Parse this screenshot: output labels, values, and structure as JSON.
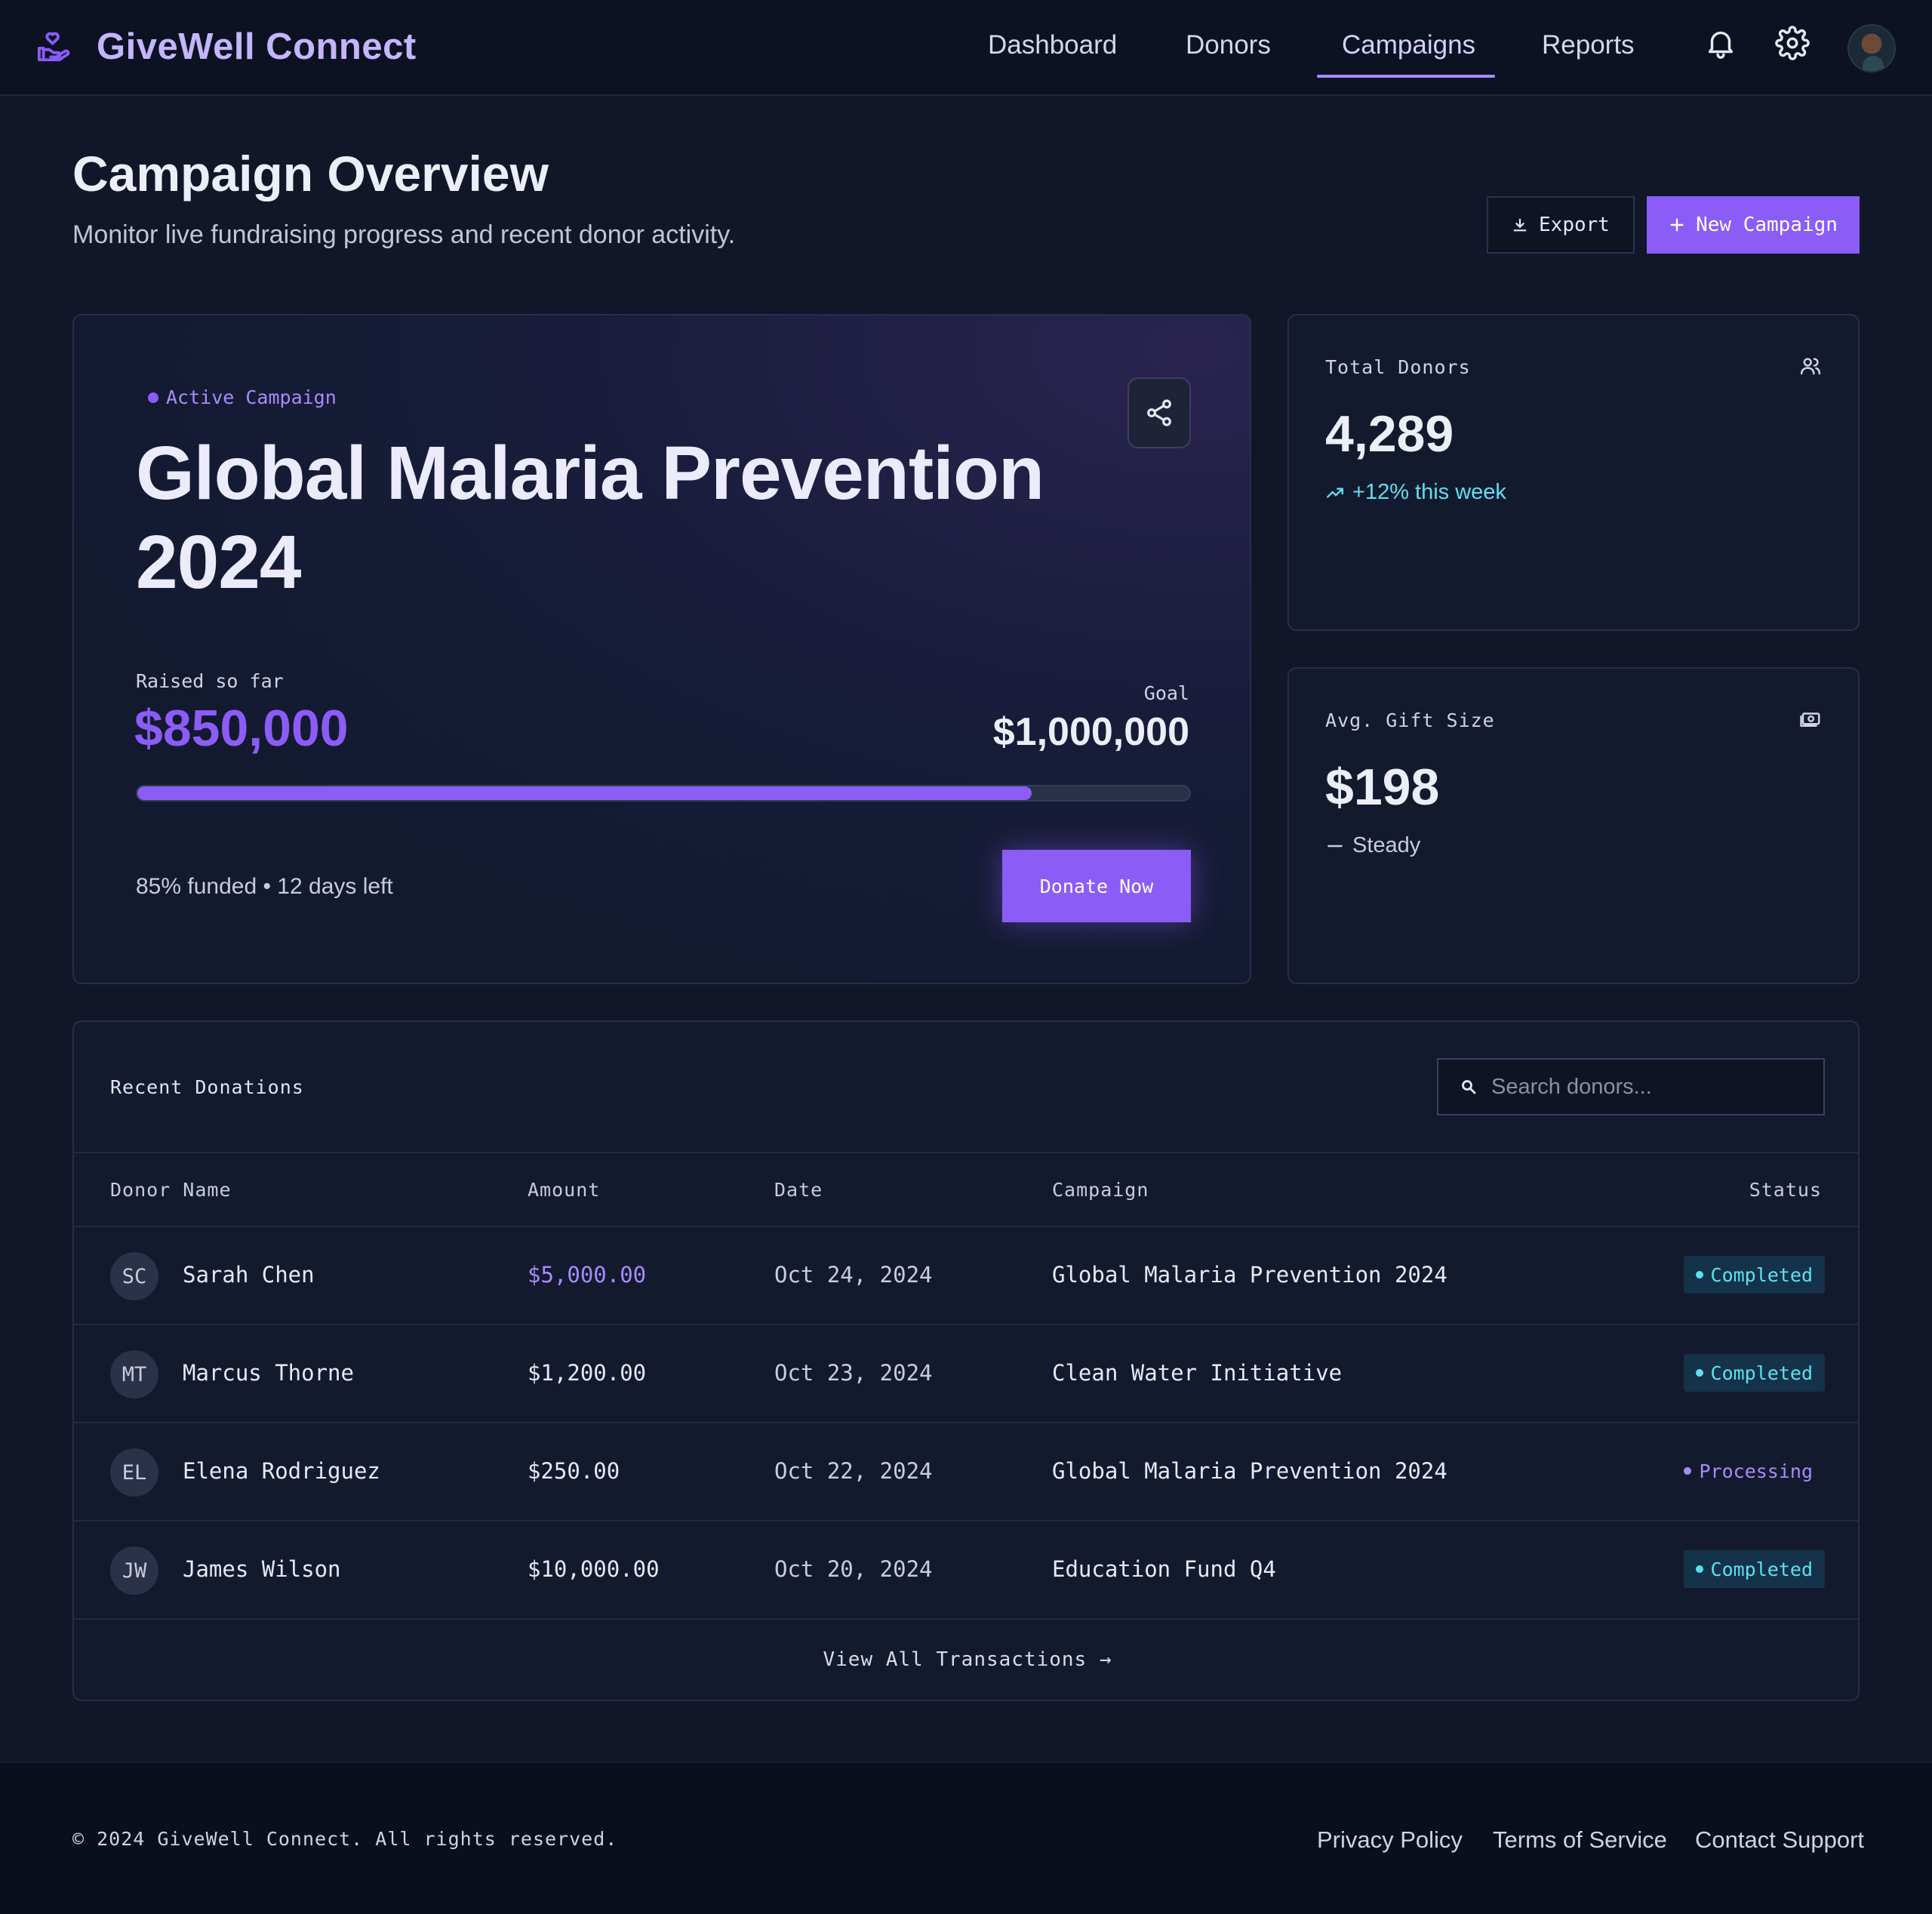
{
  "app": {
    "name": "GiveWell Connect",
    "brand_color": "#8b5cf6"
  },
  "nav": {
    "items": [
      {
        "label": "Dashboard",
        "active": false
      },
      {
        "label": "Donors",
        "active": false
      },
      {
        "label": "Campaigns",
        "active": true
      },
      {
        "label": "Reports",
        "active": false
      }
    ],
    "icons": [
      "bell-icon",
      "gear-icon",
      "avatar"
    ]
  },
  "page": {
    "title": "Campaign Overview",
    "subtitle": "Monitor live fundraising progress and recent donor activity.",
    "export_label": "Export",
    "new_campaign_label": "New Campaign"
  },
  "campaign": {
    "tag": "Active Campaign",
    "title": "Global Malaria Prevention 2024",
    "raised_label": "Raised so far",
    "raised": "$850,000",
    "goal_label": "Goal",
    "goal": "$1,000,000",
    "progress_fraction": 0.85,
    "meta": "85% funded • 12 days left",
    "donate_label": "Donate Now"
  },
  "stats": [
    {
      "label": "Total Donors",
      "value": "4,289",
      "trend": "+12% this week",
      "trend_color": "#5ee0f0",
      "icon": "users-icon"
    },
    {
      "label": "Avg. Gift Size",
      "value": "$198",
      "trend": "Steady",
      "trend_color": "#c8ccdc",
      "icon": "cash-icon"
    }
  ],
  "donations": {
    "title": "Recent Donations",
    "search_placeholder": "Search donors...",
    "columns": [
      "Donor Name",
      "Amount",
      "Date",
      "Campaign",
      "Status"
    ],
    "rows": [
      {
        "initials": "SC",
        "name": "Sarah Chen",
        "amount": "$5,000.00",
        "date": "Oct 24, 2024",
        "campaign": "Global Malaria Prevention 2024",
        "status": "Completed",
        "highlight": true
      },
      {
        "initials": "MT",
        "name": "Marcus Thorne",
        "amount": "$1,200.00",
        "date": "Oct 23, 2024",
        "campaign": "Clean Water Initiative",
        "status": "Completed",
        "highlight": false
      },
      {
        "initials": "EL",
        "name": "Elena Rodriguez",
        "amount": "$250.00",
        "date": "Oct 22, 2024",
        "campaign": "Global Malaria Prevention 2024",
        "status": "Processing",
        "highlight": false
      },
      {
        "initials": "JW",
        "name": "James Wilson",
        "amount": "$10,000.00",
        "date": "Oct 20, 2024",
        "campaign": "Education Fund Q4",
        "status": "Completed",
        "highlight": false
      }
    ],
    "view_all": "View All Transactions →"
  },
  "footer": {
    "copyright": "© 2024 GiveWell Connect. All rights reserved.",
    "links": [
      "Privacy Policy",
      "Terms of Service",
      "Contact Support"
    ]
  }
}
